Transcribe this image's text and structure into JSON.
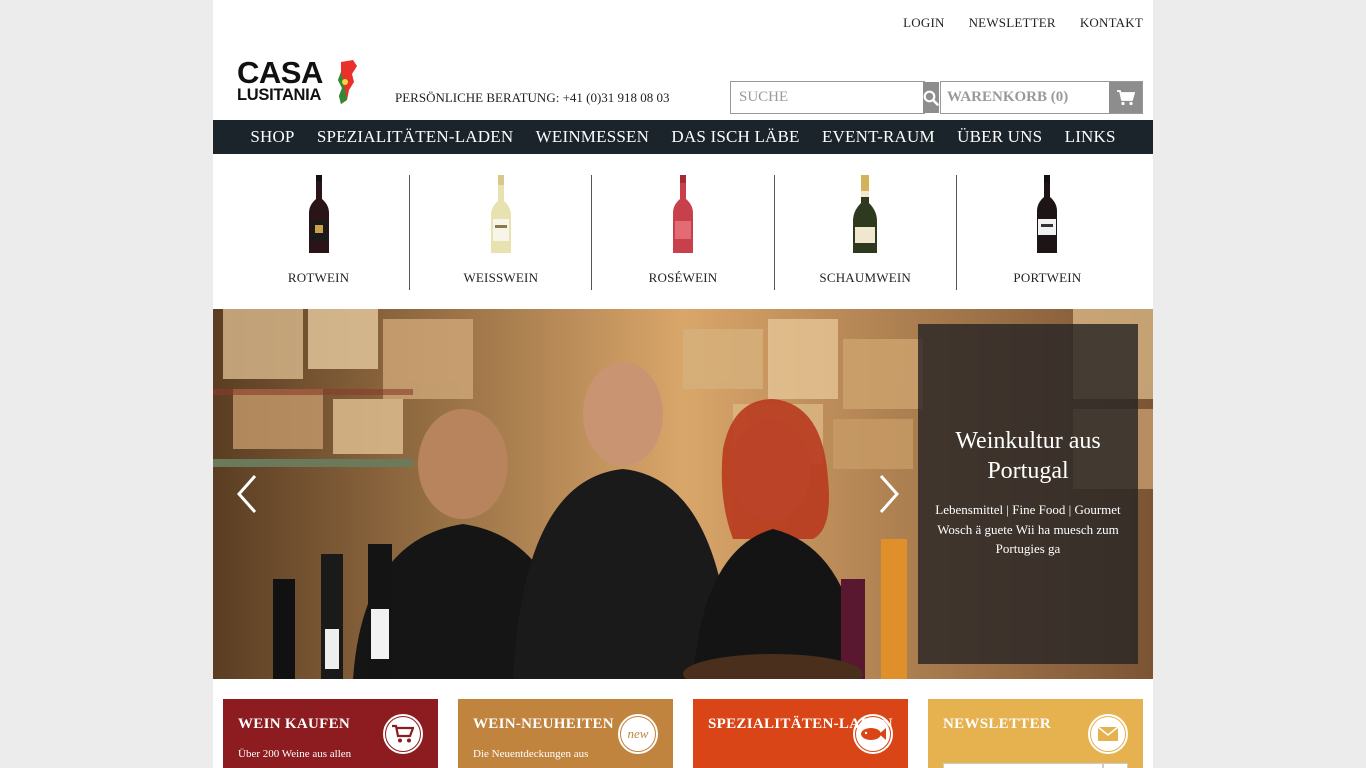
{
  "toplinks": {
    "login": "LOGIN",
    "newsletter": "NEWSLETTER",
    "kontakt": "KONTAKT"
  },
  "logo": {
    "line1": "CASA",
    "line2": "LUSITANIA"
  },
  "header": {
    "phone": "PERSÖNLICHE BERATUNG: +41 (0)31 918 08 03"
  },
  "search": {
    "placeholder": "SUCHE",
    "icon": "search-icon"
  },
  "cart": {
    "label": "WARENKORB (0)",
    "icon": "cart-icon"
  },
  "nav": [
    {
      "label": "SHOP"
    },
    {
      "label": "SPEZIALITÄTEN-LADEN"
    },
    {
      "label": "WEINMESSEN"
    },
    {
      "label": "DAS ISCH LÄBE"
    },
    {
      "label": "EVENT-RAUM"
    },
    {
      "label": "ÜBER UNS"
    },
    {
      "label": "LINKS"
    }
  ],
  "categories": [
    {
      "label": "ROTWEIN",
      "bottle_color": "#2a1418"
    },
    {
      "label": "WEISSWEIN",
      "bottle_color": "#e8e2b0"
    },
    {
      "label": "ROSÉWEIN",
      "bottle_color": "#c7404c"
    },
    {
      "label": "SCHAUMWEIN",
      "bottle_color": "#2d3a1e"
    },
    {
      "label": "PORTWEIN",
      "bottle_color": "#1d1416"
    }
  ],
  "hero": {
    "title": "Weinkultur aus Portugal",
    "line1": "Lebensmittel | Fine Food | Gourmet",
    "line2": "Wosch ä guete Wii ha muesch zum Portugies ga"
  },
  "tiles": [
    {
      "title": "WEIN KAUFEN",
      "text": "Über 200 Weine aus allen",
      "icon": "cart-icon",
      "color": "#8c1c1f"
    },
    {
      "title": "WEIN-NEUHEITEN",
      "text": "Die Neuentdeckungen aus",
      "icon": "new-badge-icon",
      "color": "#c1843e"
    },
    {
      "title": "SPEZIALITÄTEN-LADEN",
      "text": "",
      "icon": "fish-icon",
      "color": "#d94516"
    },
    {
      "title": "NEWSLETTER",
      "text": "",
      "icon": "envelope-icon",
      "color": "#e6b24f"
    }
  ]
}
